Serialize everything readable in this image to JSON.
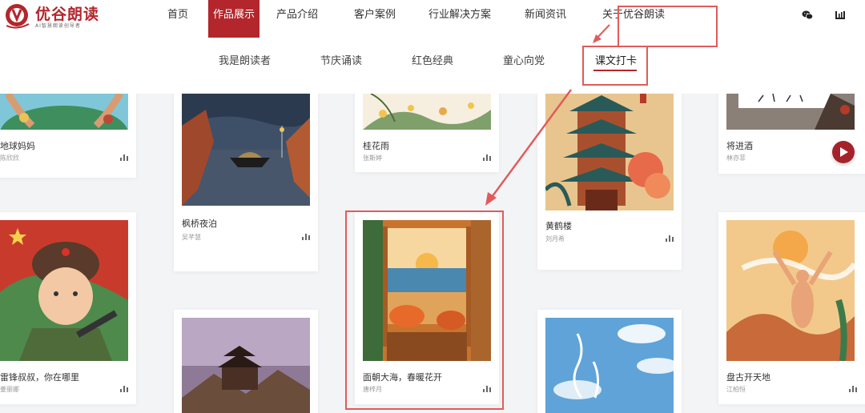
{
  "brand": {
    "name": "优谷朗读",
    "tagline": "AI智慧朗读创导者",
    "color": "#b3262c"
  },
  "nav": {
    "items": [
      {
        "label": "首页",
        "active": false
      },
      {
        "label": "作品展示",
        "active": true
      },
      {
        "label": "产品介绍",
        "active": false
      },
      {
        "label": "客户案例",
        "active": false
      },
      {
        "label": "行业解决方案",
        "active": false
      },
      {
        "label": "新闻资讯",
        "active": false
      },
      {
        "label": "关于优谷朗读",
        "active": false
      }
    ],
    "icons": [
      "wechat-icon",
      "weibo-icon"
    ]
  },
  "subnav": {
    "items": [
      {
        "label": "我是朗读者",
        "active": false
      },
      {
        "label": "节庆诵读",
        "active": false
      },
      {
        "label": "红色经典",
        "active": false
      },
      {
        "label": "童心向党",
        "active": false
      },
      {
        "label": "课文打卡",
        "active": true
      }
    ]
  },
  "cards": [
    {
      "title": "地球妈妈",
      "author": "陈欣欣"
    },
    {
      "title": "雷锋叔叔，你在哪里",
      "author": "姜丽娜"
    },
    {
      "title": "枫桥夜泊",
      "author": "吴芊慧"
    },
    {
      "title": "",
      "author": ""
    },
    {
      "title": "桂花雨",
      "author": "张斯婷"
    },
    {
      "title": "面朝大海，春暖花开",
      "author": "唐梓月"
    },
    {
      "title": "黄鹤楼",
      "author": "刘月希"
    },
    {
      "title": "",
      "author": ""
    },
    {
      "title": "将进酒",
      "author": "林亦菲"
    },
    {
      "title": "盘古开天地",
      "author": "江柏恒"
    }
  ],
  "play_button": {
    "icon": "play-icon"
  },
  "annotation": {
    "color": "#e25a5a"
  }
}
